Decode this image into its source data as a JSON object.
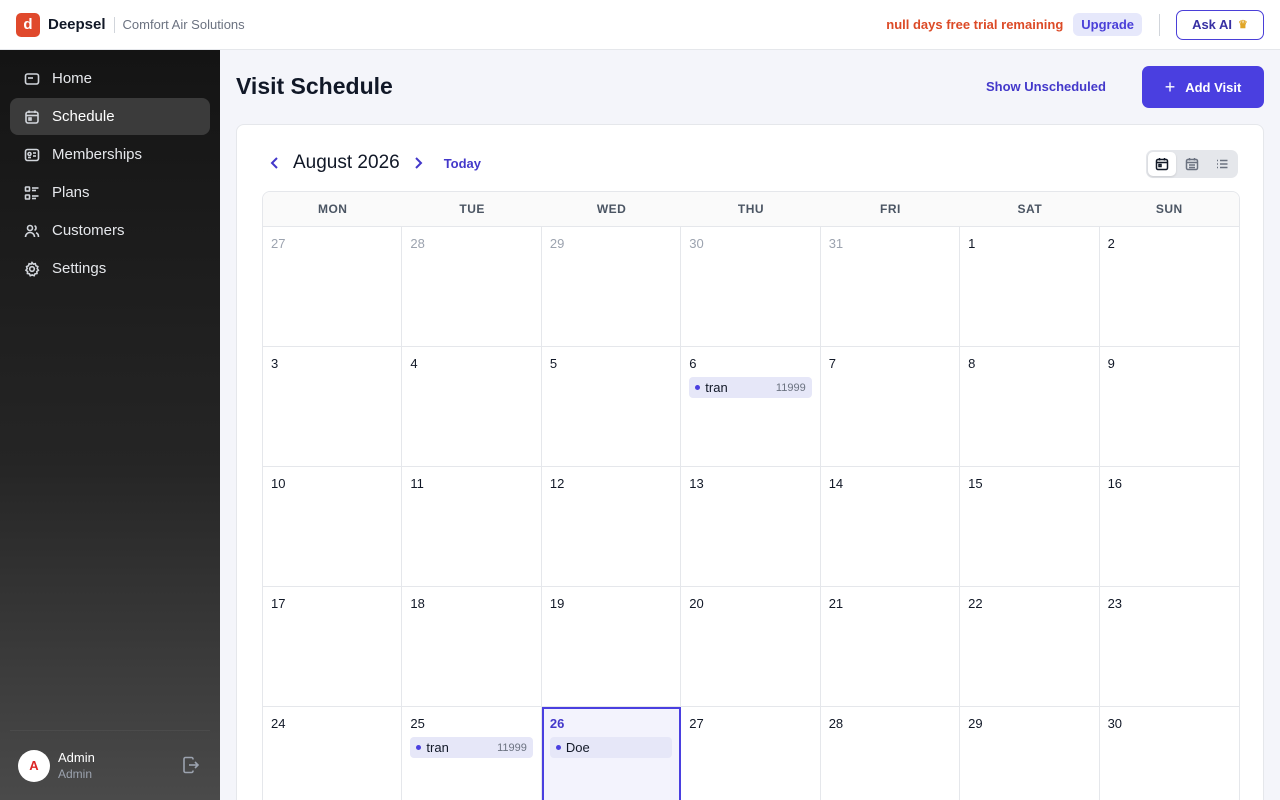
{
  "header": {
    "logo_letter": "d",
    "brand": "Deepsel",
    "company": "Comfort Air Solutions",
    "trial_text": "null days free trial remaining",
    "upgrade_label": "Upgrade",
    "ask_ai_label": "Ask AI",
    "ask_ai_icon": "crown-icon"
  },
  "sidebar": {
    "items": [
      {
        "label": "Home",
        "icon": "home-icon",
        "active": false
      },
      {
        "label": "Schedule",
        "icon": "calendar-icon",
        "active": true
      },
      {
        "label": "Memberships",
        "icon": "id-card-icon",
        "active": false
      },
      {
        "label": "Plans",
        "icon": "list-icon",
        "active": false
      },
      {
        "label": "Customers",
        "icon": "users-icon",
        "active": false
      },
      {
        "label": "Settings",
        "icon": "gear-icon",
        "active": false
      }
    ],
    "user": {
      "initial": "A",
      "name": "Admin",
      "role": "Admin"
    }
  },
  "main": {
    "title": "Visit Schedule",
    "show_unscheduled_label": "Show Unscheduled",
    "add_visit_label": "Add Visit"
  },
  "calendar": {
    "month_label": "August 2026",
    "today_label": "Today",
    "weekdays": [
      "MON",
      "TUE",
      "WED",
      "THU",
      "FRI",
      "SAT",
      "SUN"
    ],
    "weeks": [
      [
        {
          "d": "27",
          "other": true
        },
        {
          "d": "28",
          "other": true
        },
        {
          "d": "29",
          "other": true
        },
        {
          "d": "30",
          "other": true
        },
        {
          "d": "31",
          "other": true
        },
        {
          "d": "1"
        },
        {
          "d": "2"
        }
      ],
      [
        {
          "d": "3"
        },
        {
          "d": "4"
        },
        {
          "d": "5"
        },
        {
          "d": "6",
          "events": [
            {
              "title": "tran",
              "code": "11999"
            }
          ]
        },
        {
          "d": "7"
        },
        {
          "d": "8"
        },
        {
          "d": "9"
        }
      ],
      [
        {
          "d": "10"
        },
        {
          "d": "11"
        },
        {
          "d": "12"
        },
        {
          "d": "13"
        },
        {
          "d": "14"
        },
        {
          "d": "15"
        },
        {
          "d": "16"
        }
      ],
      [
        {
          "d": "17"
        },
        {
          "d": "18"
        },
        {
          "d": "19"
        },
        {
          "d": "20"
        },
        {
          "d": "21"
        },
        {
          "d": "22"
        },
        {
          "d": "23"
        }
      ],
      [
        {
          "d": "24"
        },
        {
          "d": "25",
          "events": [
            {
              "title": "tran",
              "code": "11999"
            }
          ]
        },
        {
          "d": "26",
          "today": true,
          "events": [
            {
              "title": "Doe",
              "code": ""
            }
          ]
        },
        {
          "d": "27"
        },
        {
          "d": "28"
        },
        {
          "d": "29"
        },
        {
          "d": "30"
        }
      ]
    ]
  },
  "colors": {
    "accent": "#4a3fe0",
    "trial": "#dc4a26",
    "logo": "#e0492c"
  }
}
